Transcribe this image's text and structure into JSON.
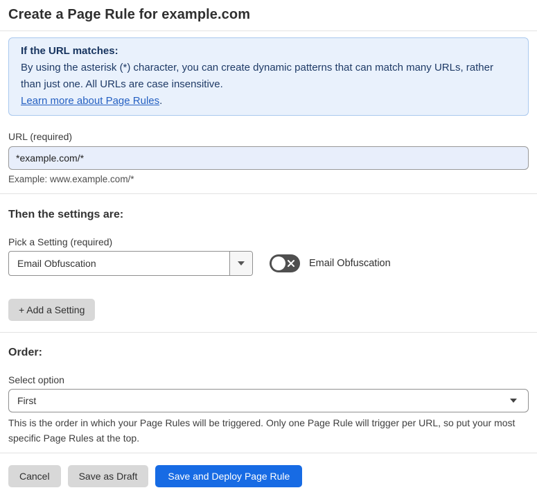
{
  "page": {
    "title": "Create a Page Rule for example.com"
  },
  "info_box": {
    "heading": "If the URL matches:",
    "body": "By using the asterisk (*) character, you can create dynamic patterns that can match many URLs, rather than just one. All URLs are case insensitive.",
    "link": "Learn more about Page Rules",
    "link_suffix": "."
  },
  "url_field": {
    "label": "URL (required)",
    "value": "*example.com/*",
    "helper": "Example: www.example.com/*"
  },
  "settings_section": {
    "heading": "Then the settings are:",
    "picker_label": "Pick a Setting (required)",
    "selected_setting": "Email Obfuscation",
    "toggle_label": "Email Obfuscation",
    "toggle_state": "off",
    "add_setting_button": "+ Add a Setting"
  },
  "order_section": {
    "heading": "Order:",
    "select_label": "Select option",
    "selected_option": "First",
    "helper": "This is the order in which your Page Rules will be triggered. Only one Page Rule will trigger per URL, so put your most specific Page Rules at the top."
  },
  "footer": {
    "cancel_label": "Cancel",
    "save_draft_label": "Save as Draft",
    "save_deploy_label": "Save and Deploy Page Rule"
  },
  "colors": {
    "accent_blue": "#176be4",
    "info_box_bg": "#e9f1fc",
    "info_box_border": "#a9c8ee",
    "info_text": "#1e3a66",
    "link_blue": "#2560c2",
    "url_input_bg": "#e8eefb",
    "toggle_off_bg": "#4f4f4f",
    "gray_button_bg": "#d8d8d8"
  }
}
